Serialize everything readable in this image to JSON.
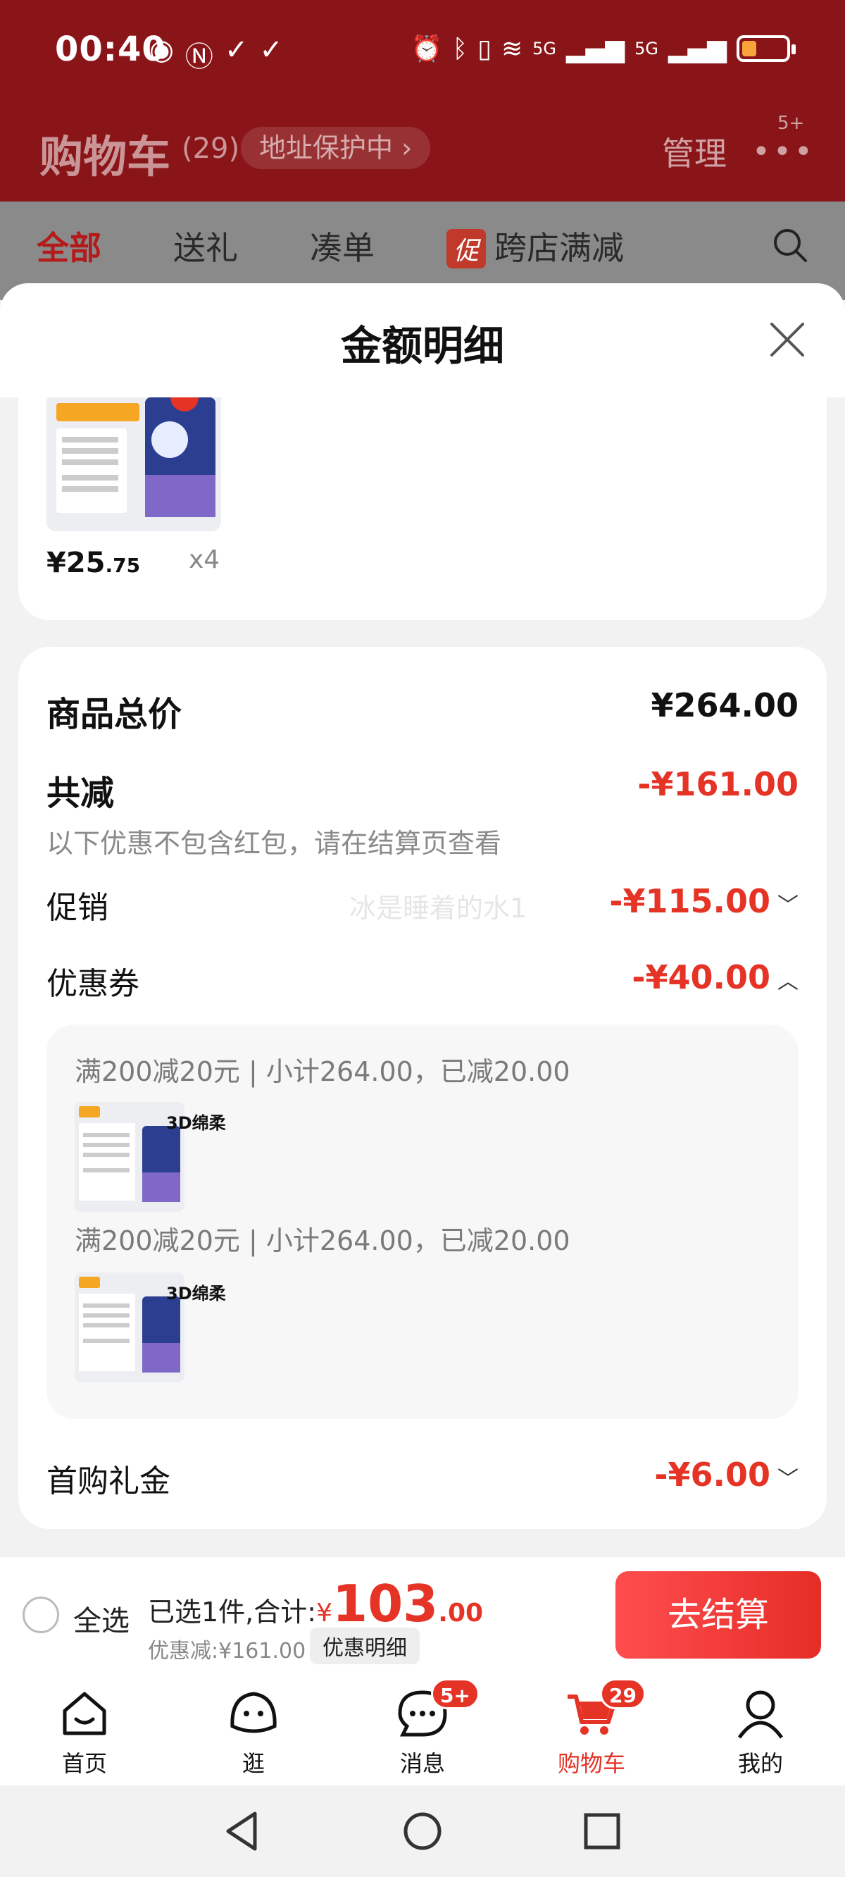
{
  "status_bar": {
    "time": "00:40",
    "network_1": "5G",
    "network_2": "5G"
  },
  "cart_header": {
    "title": "购物车",
    "count": "(29)",
    "address_pill": "地址保护中 ›",
    "manage": "管理",
    "more_badge": "5+"
  },
  "filters": {
    "all": "全部",
    "gift": "送礼",
    "bundle": "凑单",
    "promo_tag": "促",
    "cross_store": "跨店满减"
  },
  "sheet": {
    "title": "金额明细",
    "product": {
      "price_int": "¥25",
      "price_dec": ".75",
      "qty": "x4"
    },
    "total": {
      "label": "商品总价",
      "amount": "¥264.00"
    },
    "reduction": {
      "label": "共减",
      "amount": "-¥161.00",
      "note": "以下优惠不包含红包，请在结算页查看"
    },
    "promotion": {
      "label": "促销",
      "amount": "-¥115.00",
      "watermark": "冰是睡着的水1"
    },
    "coupon": {
      "label": "优惠券",
      "amount": "-¥40.00",
      "items": [
        {
          "text": "满200减20元 | 小计264.00，已减20.00",
          "thumb_text": "3D绵柔"
        },
        {
          "text": "满200减20元 | 小计264.00，已减20.00",
          "thumb_text": "3D绵柔"
        }
      ]
    },
    "first_purchase": {
      "label": "首购礼金",
      "amount": "-¥6.00"
    }
  },
  "checkout": {
    "select_all": "全选",
    "selected_prefix": "已选1件,合计:",
    "currency": "¥",
    "total_int": "103",
    "total_dec": ".00",
    "discount": "优惠减:¥161.00",
    "detail_button": "优惠明细",
    "pay_button": "去结算"
  },
  "tabbar": {
    "home": "首页",
    "browse": "逛",
    "messages": "消息",
    "messages_badge": "5+",
    "cart": "购物车",
    "cart_badge": "29",
    "me": "我的"
  },
  "colors": {
    "accent_red": "#e53326",
    "header_red": "#8a1519"
  }
}
